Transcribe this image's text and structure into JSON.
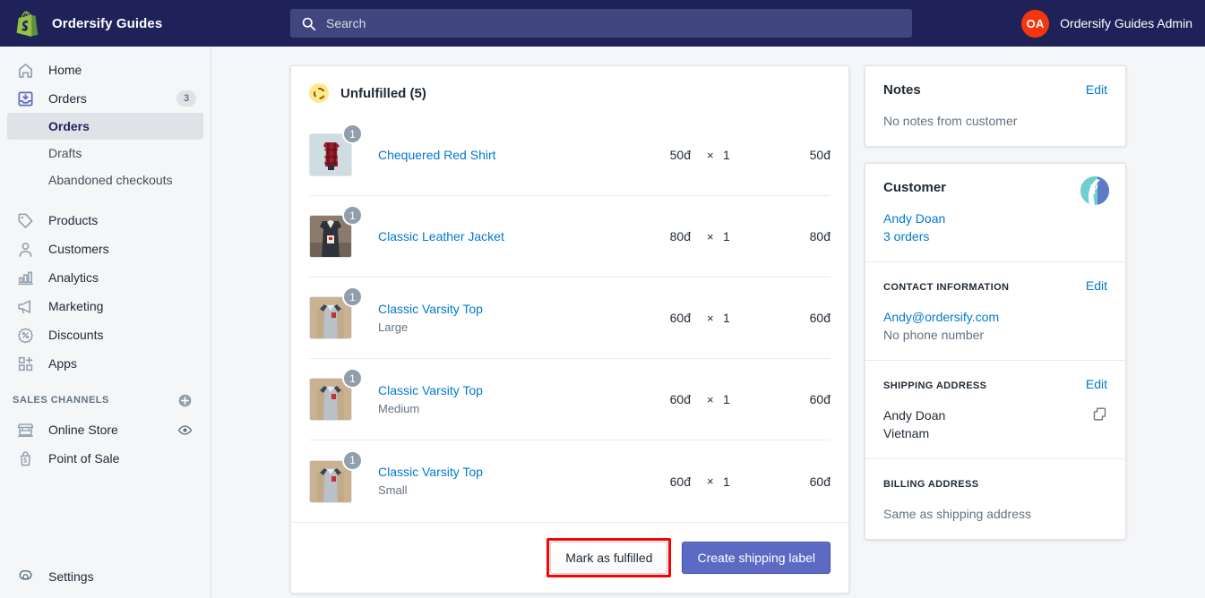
{
  "topbar": {
    "brand_name": "Ordersify Guides",
    "logo_icon": "shopify-bag-logo",
    "search": {
      "icon": "search-icon",
      "placeholder": "Search",
      "value": ""
    },
    "account": {
      "initials": "OA",
      "name": "Ordersify Guides Admin",
      "avatar_color": "#f4360f"
    },
    "background_color": "#1f2259"
  },
  "sidebar": {
    "items": [
      {
        "label": "Home",
        "icon": "home-icon",
        "badge": ""
      },
      {
        "label": "Orders",
        "icon": "orders-inbox-icon",
        "badge": "3"
      },
      {
        "label": "Products",
        "icon": "products-tag-icon",
        "badge": ""
      },
      {
        "label": "Customers",
        "icon": "customers-person-icon",
        "badge": ""
      },
      {
        "label": "Analytics",
        "icon": "analytics-bar-chart-icon",
        "badge": ""
      },
      {
        "label": "Marketing",
        "icon": "marketing-megaphone-icon",
        "badge": ""
      },
      {
        "label": "Discounts",
        "icon": "discounts-percent-badge-icon",
        "badge": ""
      },
      {
        "label": "Apps",
        "icon": "apps-grid-plus-icon",
        "badge": ""
      }
    ],
    "sub_items": [
      {
        "label": "Orders",
        "active": true
      },
      {
        "label": "Drafts",
        "active": false
      },
      {
        "label": "Abandoned checkouts",
        "active": false
      }
    ],
    "sales_channels": {
      "heading": "SALES CHANNELS",
      "add_icon": "plus-circle-icon",
      "items": [
        {
          "label": "Online Store",
          "icon": "storefront-icon",
          "trailing_icon": "eye-icon"
        },
        {
          "label": "Point of Sale",
          "icon": "point-of-sale-bag-icon",
          "trailing_icon": ""
        }
      ]
    },
    "settings": {
      "label": "Settings",
      "icon": "gear-icon"
    },
    "active_color": "#1f2259",
    "active_background": "#dfe3e8"
  },
  "fulfillment_card": {
    "status_icon": "unfulfilled-dashed-circle-icon",
    "status_color": "#ffea8a",
    "title": "Unfulfilled (5)",
    "line_items": [
      {
        "quantity_badge": "1",
        "name": "Chequered Red Shirt",
        "variant": "",
        "unit_price": "50đ",
        "times": "×",
        "quantity": "1",
        "total": "50đ",
        "thumbnail": "chequered-red-shirt-photo"
      },
      {
        "quantity_badge": "1",
        "name": "Classic Leather Jacket",
        "variant": "",
        "unit_price": "80đ",
        "times": "×",
        "quantity": "1",
        "total": "80đ",
        "thumbnail": "classic-leather-jacket-photo"
      },
      {
        "quantity_badge": "1",
        "name": "Classic Varsity Top",
        "variant": "Large",
        "unit_price": "60đ",
        "times": "×",
        "quantity": "1",
        "total": "60đ",
        "thumbnail": "classic-varsity-top-photo"
      },
      {
        "quantity_badge": "1",
        "name": "Classic Varsity Top",
        "variant": "Medium",
        "unit_price": "60đ",
        "times": "×",
        "quantity": "1",
        "total": "60đ",
        "thumbnail": "classic-varsity-top-photo"
      },
      {
        "quantity_badge": "1",
        "name": "Classic Varsity Top",
        "variant": "Small",
        "unit_price": "60đ",
        "times": "×",
        "quantity": "1",
        "total": "60đ",
        "thumbnail": "classic-varsity-top-photo"
      }
    ],
    "actions": {
      "mark_as_fulfilled": "Mark as fulfilled",
      "create_shipping_label": "Create shipping label",
      "highlight_color": "#ff0000",
      "primary_color": "#5c6ac4"
    }
  },
  "notes_card": {
    "title": "Notes",
    "edit_label": "Edit",
    "body": "No notes from customer"
  },
  "customer_card": {
    "title": "Customer",
    "avatar_icon": "customer-avatar",
    "name": "Andy Doan",
    "orders_count": "3 orders",
    "contact": {
      "heading": "CONTACT INFORMATION",
      "edit_label": "Edit",
      "email": "Andy@ordersify.com",
      "phone": "No phone number"
    },
    "shipping": {
      "heading": "SHIPPING ADDRESS",
      "edit_label": "Edit",
      "copy_icon": "copy-icon",
      "line1": "Andy Doan",
      "line2": "Vietnam"
    },
    "billing": {
      "heading": "BILLING ADDRESS",
      "body": "Same as shipping address"
    }
  }
}
